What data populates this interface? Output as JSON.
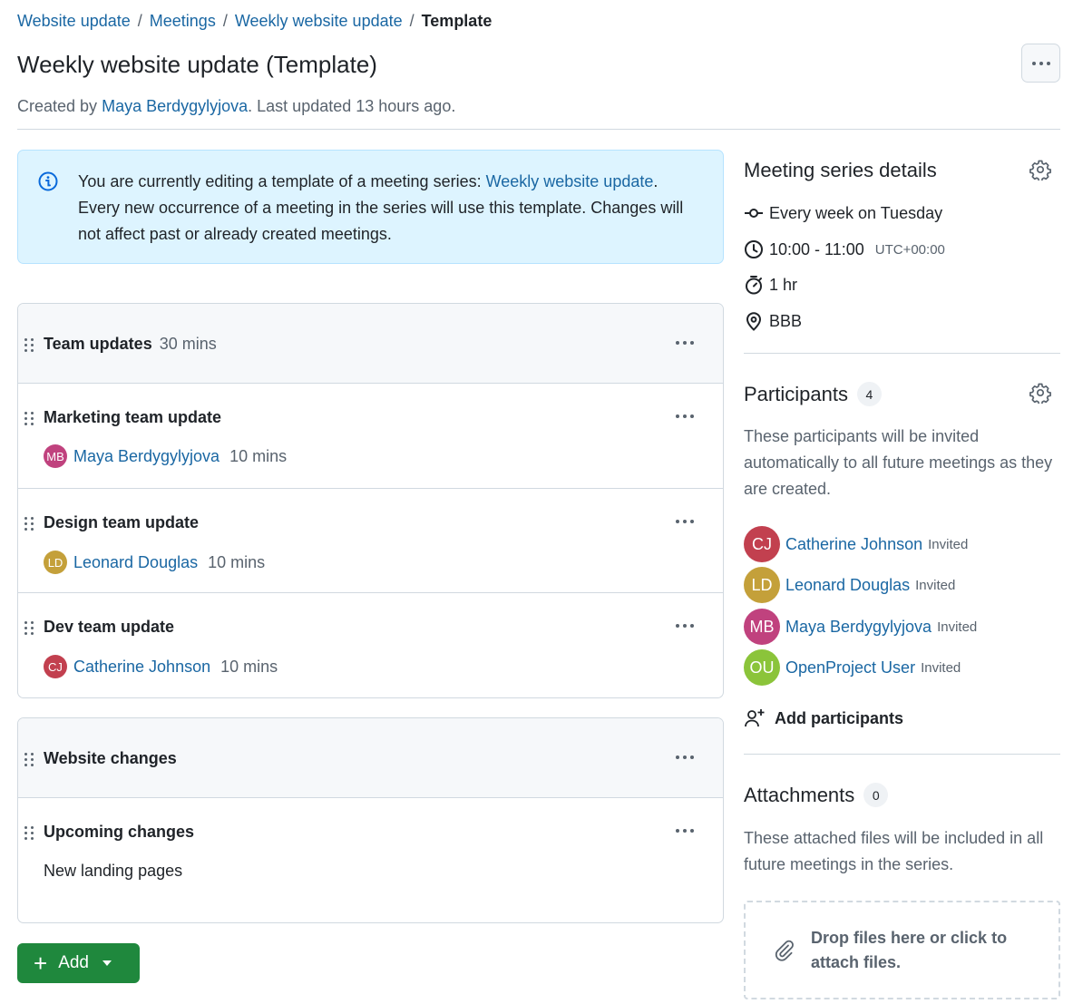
{
  "breadcrumb": {
    "items": [
      "Website update",
      "Meetings",
      "Weekly website update"
    ],
    "separator": "/",
    "current": "Template"
  },
  "page": {
    "title": "Weekly website update (Template)",
    "created_prefix": "Created by",
    "author": "Maya Berdygylyjova",
    "updated_text": ". Last updated 13 hours ago."
  },
  "banner": {
    "text_before": "You are currently editing a template of a meeting series: ",
    "link": "Weekly website update",
    "text_after": ". Every new occurrence of a meeting in the series will use this template. Changes will not affect past or already created meetings."
  },
  "sections": [
    {
      "title": "Team updates",
      "duration": "30 mins",
      "items": [
        {
          "title": "Marketing team update",
          "presenter": "Maya Berdygylyjova",
          "initials": "MB",
          "duration": "10 mins"
        },
        {
          "title": "Design team update",
          "presenter": "Leonard Douglas",
          "initials": "LD",
          "duration": "10 mins"
        },
        {
          "title": "Dev team update",
          "presenter": "Catherine Johnson",
          "initials": "CJ",
          "duration": "10 mins"
        }
      ]
    },
    {
      "title": "Website changes",
      "duration": "",
      "items": [
        {
          "title": "Upcoming changes",
          "notes": "New landing pages"
        }
      ]
    }
  ],
  "add_button": {
    "label": "Add"
  },
  "series_details": {
    "title": "Meeting series details",
    "recurrence": "Every week on Tuesday",
    "time": "10:00 - 11:00",
    "timezone": "UTC+00:00",
    "duration": "1 hr",
    "location": "BBB"
  },
  "participants": {
    "title": "Participants",
    "count": "4",
    "description": "These participants will be invited automatically to all future meetings as they are created.",
    "list": [
      {
        "name": "Catherine Johnson",
        "initials": "CJ",
        "status": "Invited"
      },
      {
        "name": "Leonard Douglas",
        "initials": "LD",
        "status": "Invited"
      },
      {
        "name": "Maya Berdygylyjova",
        "initials": "MB",
        "status": "Invited"
      },
      {
        "name": "OpenProject User",
        "initials": "OU",
        "status": "Invited"
      }
    ],
    "add_label": "Add participants"
  },
  "attachments": {
    "title": "Attachments",
    "count": "0",
    "description": "These attached files will be included in all future meetings in the series.",
    "dropzone_line1": "Drop files here or click to",
    "dropzone_line2": "attach files."
  },
  "colors": {
    "avatar_mb": "#c0427e",
    "avatar_ld": "#c4a03a",
    "avatar_cj": "#c2404f",
    "avatar_ou": "#8bc43a",
    "primary_button": "#1f883d",
    "link": "#1a67a3",
    "banner_bg": "#ddf4ff"
  }
}
